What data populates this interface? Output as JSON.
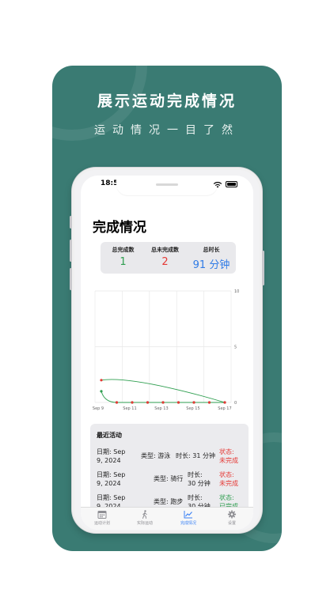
{
  "promo": {
    "headline": "展示运动完成情况",
    "subline": "运动情况一目了然"
  },
  "status_bar": {
    "time": "18:5("
  },
  "page": {
    "title": "完成情况"
  },
  "stats": [
    {
      "label": "总完成数",
      "value": "1",
      "color": "#2e9e4f"
    },
    {
      "label": "总未完成数",
      "value": "2",
      "color": "#e53935"
    },
    {
      "label": "总时长",
      "value": "91 分钟",
      "color": "#2f7be6"
    }
  ],
  "chart_data": {
    "type": "line",
    "x_ticks": [
      "Sep 9",
      "Sep 11",
      "Sep 13",
      "Sep 15",
      "Sep 17"
    ],
    "y_ticks": [
      "10",
      "5",
      "0"
    ],
    "ylim": [
      0,
      10
    ],
    "grid": true,
    "series": [
      {
        "color": "#2e9e4f",
        "values": [
          1,
          0,
          0,
          0,
          0,
          0,
          0,
          0,
          0
        ]
      },
      {
        "color": "#e53935",
        "values": [
          2,
          0,
          0,
          0,
          0,
          0,
          0,
          0,
          0
        ]
      }
    ]
  },
  "recent": {
    "title": "最近活动",
    "items": [
      {
        "date_line1": "日期: Sep",
        "date_line2": "9, 2024",
        "type": "类型: 游泳",
        "duration_line1": "时长: 31 分钟",
        "duration_line2": "",
        "status_line1": "状态:",
        "status_line2": "未完成",
        "status_color": "#e53935"
      },
      {
        "date_line1": "日期: Sep",
        "date_line2": "9, 2024",
        "type": "类型: 骑行",
        "duration_line1": "时长:",
        "duration_line2": "30 分钟",
        "status_line1": "状态:",
        "status_line2": "未完成",
        "status_color": "#e53935"
      },
      {
        "date_line1": "日期: Sep",
        "date_line2": "9, 2024",
        "type": "类型: 跑步",
        "duration_line1": "时长:",
        "duration_line2": "30 分钟",
        "status_line1": "状态:",
        "status_line2": "已完成",
        "status_color": "#2e9e4f"
      }
    ]
  },
  "tabs": [
    {
      "label": "运动计划",
      "icon": "calendar-icon"
    },
    {
      "label": "实际运动",
      "icon": "walking-icon"
    },
    {
      "label": "完成情况",
      "icon": "chart-line-icon",
      "active": true
    },
    {
      "label": "设置",
      "icon": "gear-icon"
    }
  ]
}
